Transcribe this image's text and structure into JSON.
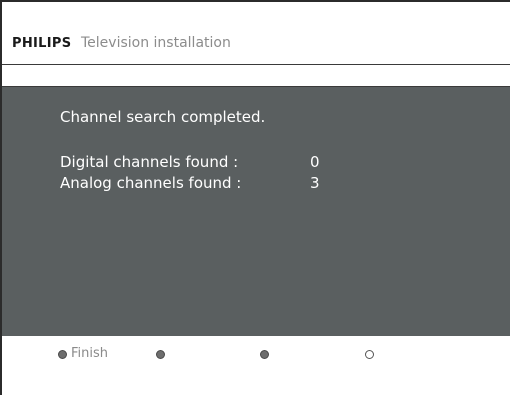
{
  "header": {
    "brand": "PHILIPS",
    "title": "Television installation"
  },
  "panel": {
    "status": "Channel search completed.",
    "digital_label": "Digital channels found :",
    "digital_count": "0",
    "analog_label": "Analog channels found :",
    "analog_count": "3",
    "background_color": "#5a5f60"
  },
  "footer": {
    "buttons": [
      {
        "label": "Finish",
        "icon": "red-button-dot",
        "style": "filled"
      },
      {
        "label": "",
        "icon": "green-button-dot",
        "style": "filled"
      },
      {
        "label": "",
        "icon": "yellow-button-dot",
        "style": "filled"
      },
      {
        "label": "",
        "icon": "blue-button-dot",
        "style": "hollow"
      }
    ]
  }
}
